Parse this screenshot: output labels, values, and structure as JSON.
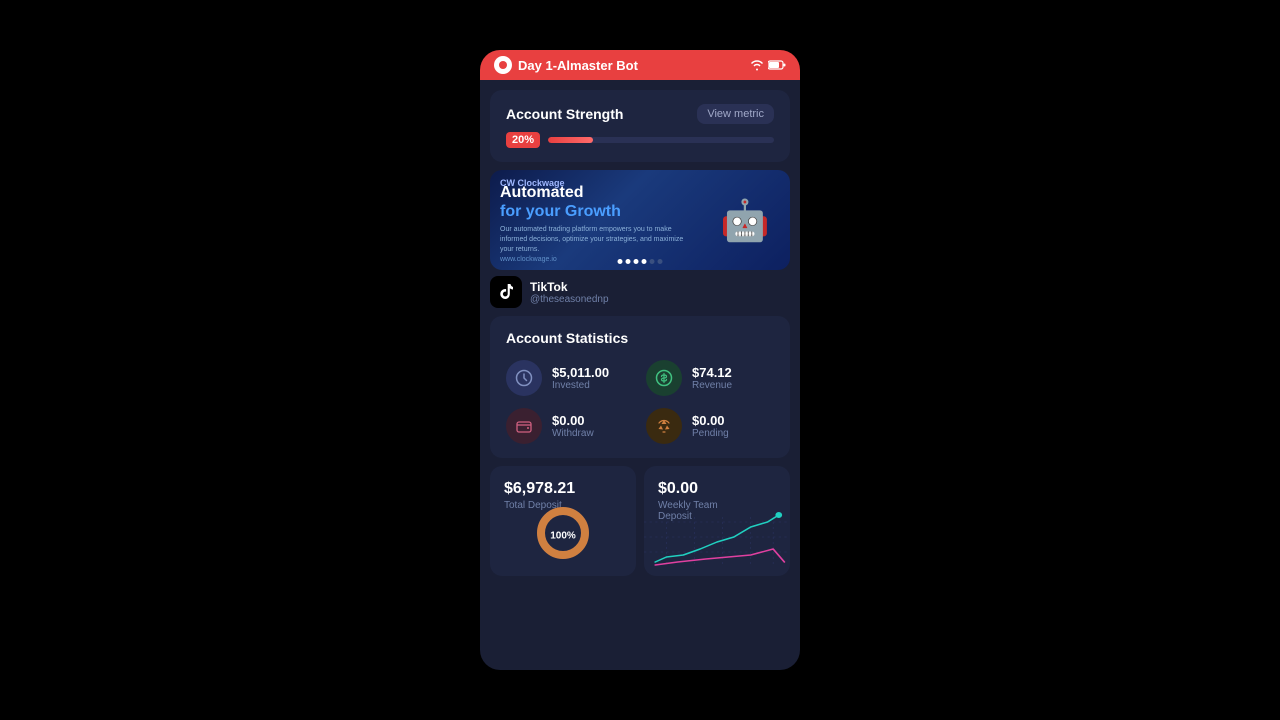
{
  "statusBar": {
    "title": "Day 1-Almaster Bot",
    "wifiIcon": "wifi",
    "batteryIcon": "battery"
  },
  "accountStrength": {
    "title": "Account Strength",
    "viewMetricLabel": "View metric",
    "progressPercent": 20,
    "progressLabel": "20%"
  },
  "banner": {
    "logo": "CW Clockwage",
    "headline1": "Automated",
    "headline2": "for your Growth",
    "subtext": "Our automated trading platform empowers you to make informed decisions, optimize your strategies, and maximize your returns.",
    "url": "www.clockwage.io",
    "dots": [
      true,
      true,
      true,
      true,
      false,
      false
    ]
  },
  "tiktok": {
    "label": "TikTok",
    "username": "@theseasonednp"
  },
  "accountStats": {
    "title": "Account Statistics",
    "items": [
      {
        "value": "$5,011.00",
        "label": "Invested",
        "icon": "clock"
      },
      {
        "value": "$74.12",
        "label": "Revenue",
        "icon": "dollar"
      },
      {
        "value": "$0.00",
        "label": "Withdraw",
        "icon": "wallet"
      },
      {
        "value": "$0.00",
        "label": "Pending",
        "icon": "recycle"
      }
    ]
  },
  "bottomCards": [
    {
      "value": "$6,978.21",
      "label": "Total Deposit",
      "chartType": "donut",
      "donutPercent": 100,
      "donutLabel": "100%"
    },
    {
      "value": "$0.00",
      "label": "Weekly Team\nDeposit",
      "chartType": "line"
    }
  ]
}
